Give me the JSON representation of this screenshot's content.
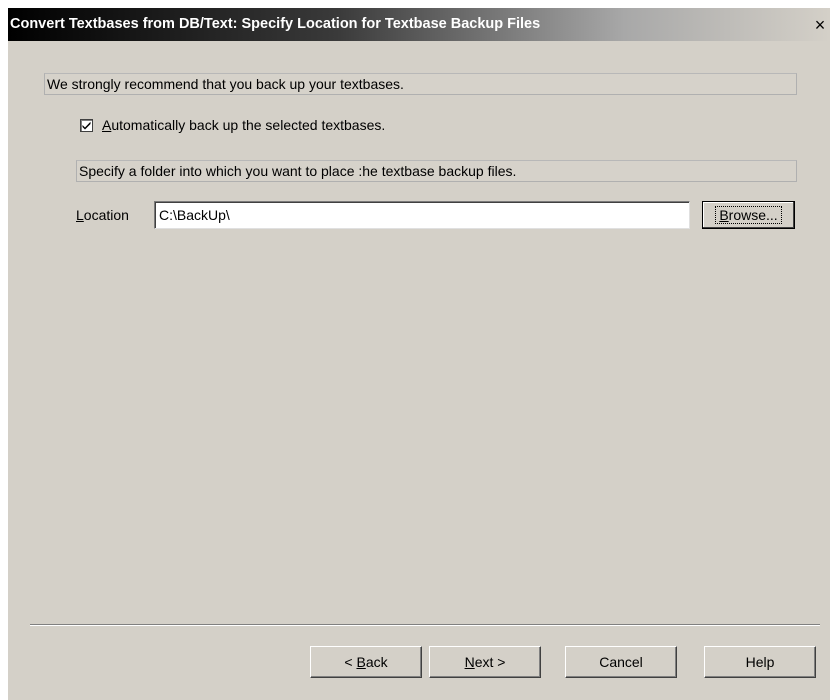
{
  "window": {
    "title": "Convert Textbases from DB/Text: Specify Location for Textbase Backup Files",
    "close_label": "×"
  },
  "recommendation": {
    "text": "We strongly recommend that you back up your textbases."
  },
  "auto_backup": {
    "checked": true,
    "label_accel": "A",
    "label_rest": "utomatically back up the selected textbases."
  },
  "folder_prompt": {
    "text": "Specify a folder into which you want to place :he textbase backup files."
  },
  "location": {
    "label_accel": "L",
    "label_rest": "ocation",
    "value": "C:\\BackUp\\"
  },
  "browse": {
    "accel": "B",
    "rest": "rowse..."
  },
  "buttons": {
    "back": {
      "prefix": "< ",
      "accel": "B",
      "rest": "ack"
    },
    "next": {
      "accel": "N",
      "rest": "ext >"
    },
    "cancel": {
      "label": "Cancel"
    },
    "help": {
      "label": "Help"
    }
  },
  "colors": {
    "dialog_bg": "#d4d0c8",
    "title_text": "#ffffff"
  }
}
